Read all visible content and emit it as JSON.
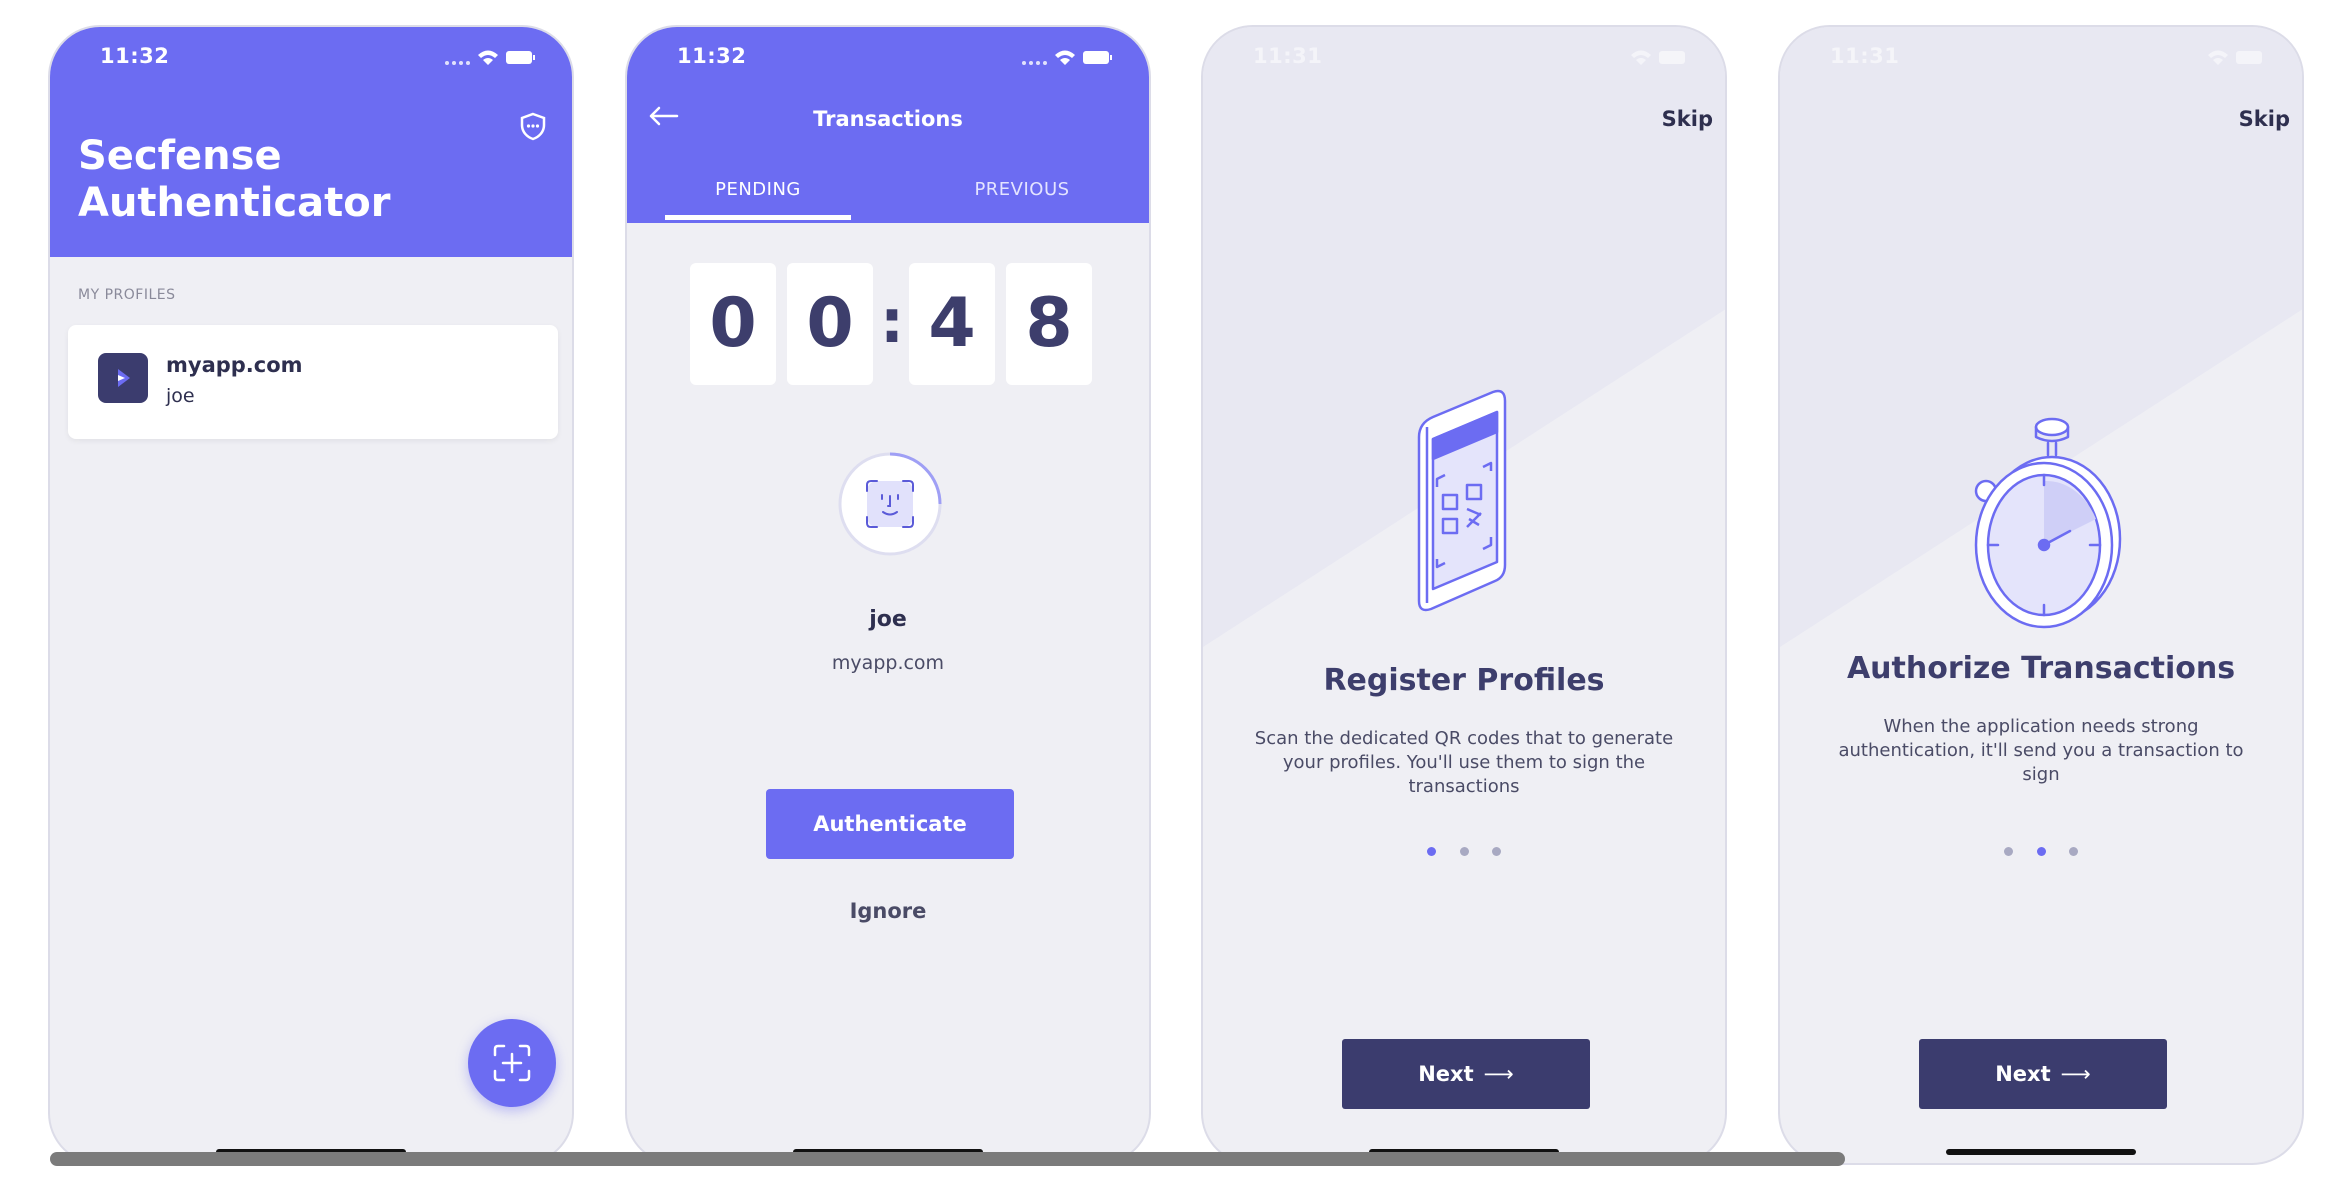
{
  "screens": {
    "home": {
      "time": "11:32",
      "title": "Secfense Authenticator",
      "section_label": "MY PROFILES",
      "profile": {
        "domain": "myapp.com",
        "user": "joe"
      }
    },
    "transactions": {
      "time": "11:32",
      "title": "Transactions",
      "tabs": [
        "PENDING",
        "PREVIOUS"
      ],
      "timer_digits": [
        "0",
        "0",
        "4",
        "8"
      ],
      "timer_separator": ":",
      "user": "joe",
      "domain": "myapp.com",
      "authenticate_label": "Authenticate",
      "ignore_label": "Ignore"
    },
    "onboarding_register": {
      "time": "11:31",
      "skip_label": "Skip",
      "title": "Register Profiles",
      "description": "Scan the dedicated QR codes that to generate your profiles. You'll use them to sign the transactions",
      "next_label": "Next",
      "active_dot": 0
    },
    "onboarding_authorize": {
      "time": "11:31",
      "skip_label": "Skip",
      "title": "Authorize Transactions",
      "description": "When the application needs strong authentication, it'll send you a transaction to sign",
      "next_label": "Next",
      "active_dot": 1
    }
  },
  "colors": {
    "primary": "#6c6cf2",
    "dark": "#3b3c6e",
    "background": "#efeff4"
  },
  "icons": {
    "shield": "shield-dots-icon",
    "fab": "qr-scan-add-icon",
    "back": "back-arrow-icon",
    "face": "face-id-icon",
    "next_arrow": "arrow-right-icon"
  }
}
